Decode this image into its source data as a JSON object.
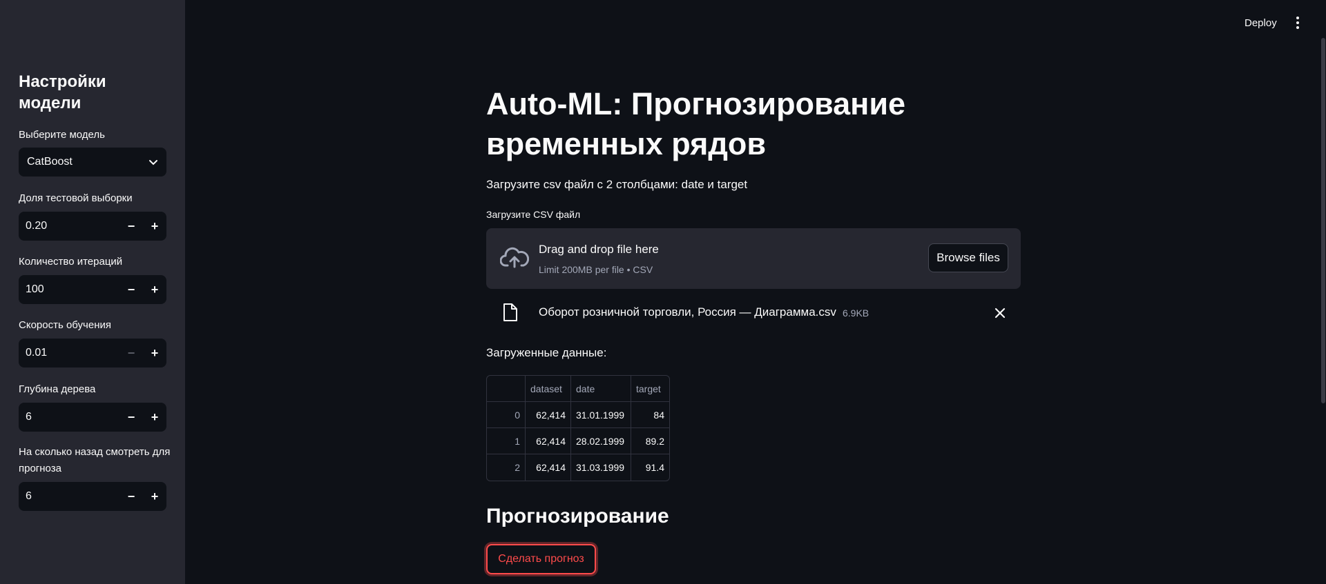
{
  "header": {
    "deploy_label": "Deploy",
    "menu_icon": "vertical-dots-icon"
  },
  "sidebar": {
    "title": "Настройки модели",
    "model_select": {
      "label": "Выберите модель",
      "value": "CatBoost"
    },
    "inputs": [
      {
        "label": "Доля тестовой выборки",
        "value": "0.20",
        "minus_disabled": false
      },
      {
        "label": "Количество итераций",
        "value": "100",
        "minus_disabled": false
      },
      {
        "label": "Скорость обучения",
        "value": "0.01",
        "minus_disabled": true
      },
      {
        "label": "Глубина дерева",
        "value": "6",
        "minus_disabled": false
      },
      {
        "label": "На сколько назад смотреть для прогноза",
        "value": "6",
        "minus_disabled": false
      }
    ],
    "minus": "−",
    "plus": "+"
  },
  "main": {
    "title": "Auto-ML: Прогнозирование временных рядов",
    "subtitle": "Загрузите csv файл с 2 столбцами: date и target",
    "uploader": {
      "label": "Загрузите CSV файл",
      "drop_text": "Drag and drop file here",
      "limit_text": "Limit 200MB per file • CSV",
      "browse_label": "Browse files"
    },
    "file": {
      "name": "Оборот розничной торговли, Россия — Диаграмма.csv",
      "size": "6.9KB"
    },
    "loaded_label": "Загруженные данные:",
    "table": {
      "columns": [
        "",
        "dataset",
        "date",
        "target"
      ],
      "rows": [
        [
          "0",
          "62,414",
          "31.01.1999",
          "84"
        ],
        [
          "1",
          "62,414",
          "28.02.1999",
          "89.2"
        ],
        [
          "2",
          "62,414",
          "31.03.1999",
          "91.4"
        ]
      ]
    },
    "forecast_heading": "Прогнозирование",
    "predict_button": "Сделать прогноз"
  },
  "colors": {
    "accent": "#ff4b4b",
    "bg": "#0e1117",
    "sidebar": "#262730"
  }
}
